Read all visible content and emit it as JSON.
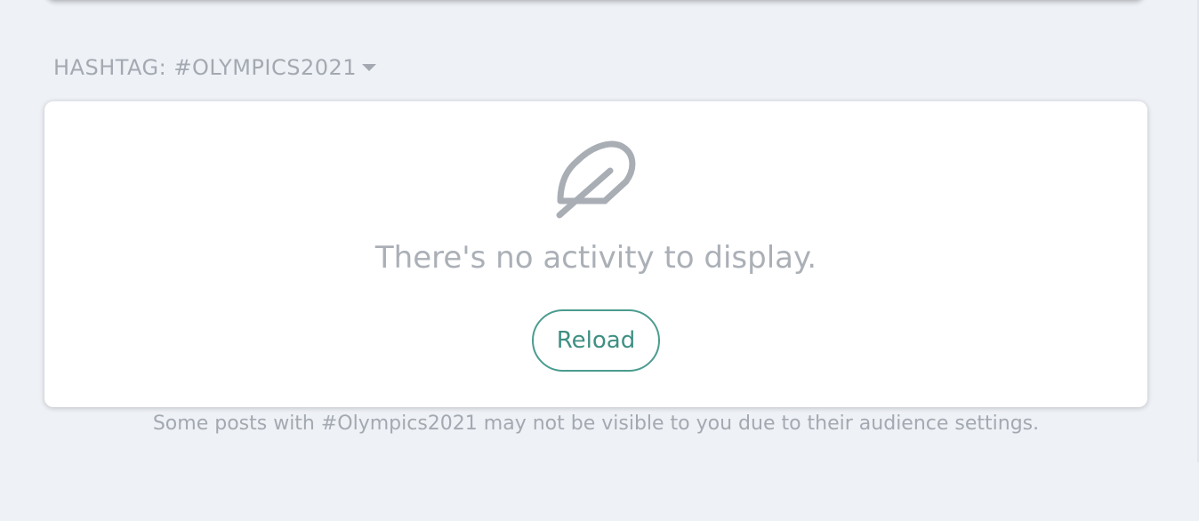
{
  "hashtag": {
    "title": "HASHTAG: #OLYMPICS2021"
  },
  "activity": {
    "empty_message": "There's no activity to display.",
    "reload_label": "Reload",
    "icon": "feather-icon"
  },
  "footer": {
    "visibility_note": "Some posts with #Olympics2021 may not be visible to you due to their audience settings."
  },
  "colors": {
    "background": "#eef1f6",
    "card": "#ffffff",
    "muted_text": "#a4a9b1",
    "accent": "#4b9c8f"
  }
}
